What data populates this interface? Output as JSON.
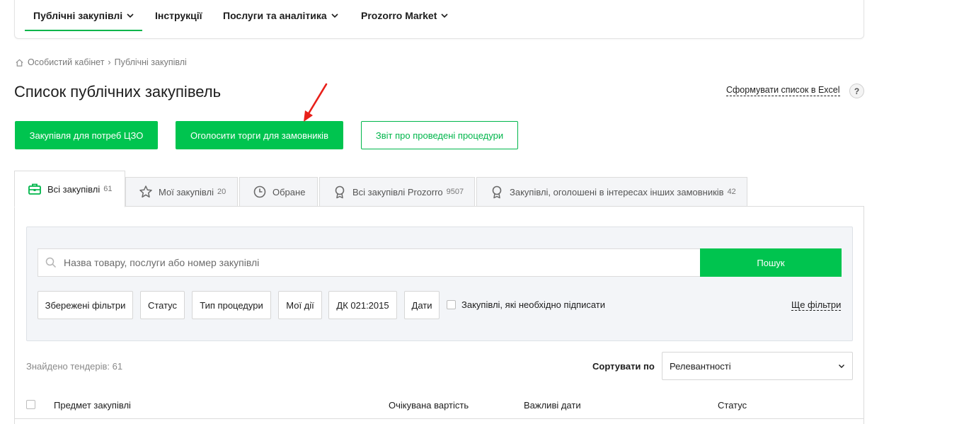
{
  "nav": {
    "items": [
      {
        "label": "Публічні закупівлі",
        "dropdown": true,
        "active": true
      },
      {
        "label": "Інструкції",
        "dropdown": false,
        "active": false
      },
      {
        "label": "Послуги та аналітика",
        "dropdown": true,
        "active": false
      },
      {
        "label": "Prozorro Market",
        "dropdown": true,
        "active": false
      }
    ]
  },
  "breadcrumb": {
    "icon": "home-icon",
    "items": [
      "Особистий кабінет",
      "Публічні закупівлі"
    ],
    "separator": "›"
  },
  "page": {
    "title": "Список публічних закупівель",
    "excel_link": "Сформувати список в Excel",
    "help_label": "?"
  },
  "actions": {
    "cpb_purchase": "Закупівля для потреб ЦЗО",
    "announce_tender": "Оголосити торги для замовників",
    "procedures_report": "Звіт про проведені процедури"
  },
  "tabs": [
    {
      "label": "Всі закупівлі",
      "count": "61",
      "icon": "briefcase-icon",
      "active": true
    },
    {
      "label": "Мої закупівлі",
      "count": "20",
      "icon": "star-icon",
      "active": false
    },
    {
      "label": "Обране",
      "count": "",
      "icon": "clock-icon",
      "active": false
    },
    {
      "label": "Всі закупівлі Prozorro",
      "count": "9507",
      "icon": "award-icon",
      "active": false
    },
    {
      "label": "Закупівлі, оголошені в інтересах інших замовників",
      "count": "42",
      "icon": "award-icon",
      "active": false
    }
  ],
  "search": {
    "placeholder": "Назва товару, послуги або номер закупівлі",
    "value": "",
    "button": "Пошук"
  },
  "filters": {
    "saved": "Збережені фільтри",
    "status": "Статус",
    "procedure_type": "Тип процедури",
    "my_actions": "Мої дії",
    "dk": "ДК 021:2015",
    "dates": "Дати",
    "need_sign_label": "Закупівлі, які необхідно підписати",
    "need_sign_checked": false,
    "more": "Ще фільтри"
  },
  "results": {
    "found_text": "Знайдено тендерів: 61",
    "sort_label": "Сортувати по",
    "sort_value": "Релевантності"
  },
  "table": {
    "headers": [
      "Предмет закупівлі",
      "Очікувана вартість",
      "Важливі дати",
      "Статус"
    ]
  },
  "colors": {
    "accent_green": "#00c44f",
    "arrow_red": "#e8201a"
  }
}
